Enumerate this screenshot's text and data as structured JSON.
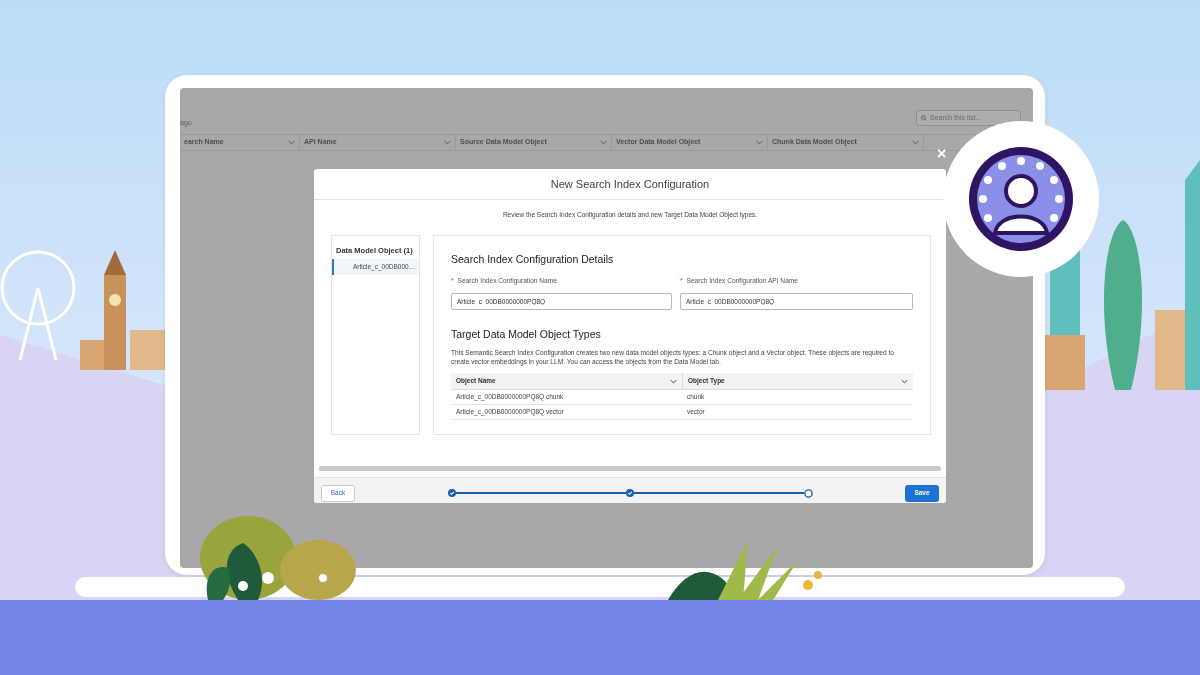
{
  "background_app": {
    "updated": "ago",
    "search": {
      "placeholder": "Search this list..."
    },
    "columns": [
      "earch Name",
      "API Name",
      "Source Data Model Object",
      "Vector Data Model Object",
      "Chunk Data Model Object"
    ]
  },
  "modal": {
    "close": "×",
    "title": "New Search Index Configuration",
    "intro": "Review the Search Index Configuration details and new Target Data Model Object types.",
    "sidebar": {
      "heading": "Data Model Object (1)",
      "items": [
        {
          "label": "Article_c_00DB000…",
          "selected": true
        }
      ]
    },
    "details": {
      "heading": "Search Index Configuration Details",
      "fields": [
        {
          "required_mark": "*",
          "label": "Search Index Configuration Name",
          "value": "Article_c_00DB0000000PQ8Q"
        },
        {
          "required_mark": "*",
          "label": "Search Index Configuration API Name",
          "value": "Article_c_00DB0000000PQ8Q"
        }
      ]
    },
    "types": {
      "heading": "Target Data Model Object Types",
      "description": "This Semantic Search Index Configuration creates two new  data model objects types: a Chunk object and a Vector object. These objects are required to create vector embeddings in your LLM. You can access the objects from the Data Model tab.",
      "columns": [
        "Object Name",
        "Object Type"
      ],
      "rows": [
        [
          "Article_c_00DB0000000PQ8Q chunk",
          "chunk"
        ],
        [
          "Article_c_00DB0000000PQ8Q vector",
          "vector"
        ]
      ]
    },
    "steps": [
      {
        "completed": true
      },
      {
        "completed": true
      },
      {
        "completed": false
      }
    ],
    "back": "Back",
    "save": "Save"
  }
}
